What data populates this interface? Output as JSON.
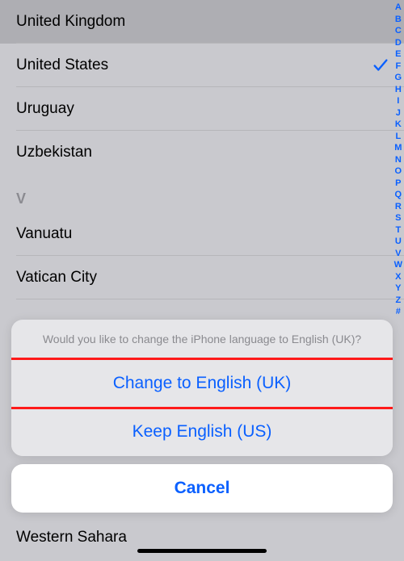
{
  "list": {
    "items": [
      {
        "label": "United Kingdom",
        "selected": false,
        "highlighted": true
      },
      {
        "label": "United States",
        "selected": true,
        "highlighted": false
      },
      {
        "label": "Uruguay",
        "selected": false,
        "highlighted": false
      },
      {
        "label": "Uzbekistan",
        "selected": false,
        "highlighted": false
      }
    ],
    "section": "V",
    "v_items": [
      {
        "label": "Vanuatu"
      },
      {
        "label": "Vatican City"
      }
    ],
    "bottom_item": "Western Sahara"
  },
  "index": [
    "A",
    "B",
    "C",
    "D",
    "E",
    "F",
    "G",
    "H",
    "I",
    "J",
    "K",
    "L",
    "M",
    "N",
    "O",
    "P",
    "Q",
    "R",
    "S",
    "T",
    "U",
    "V",
    "W",
    "X",
    "Y",
    "Z",
    "#"
  ],
  "sheet": {
    "title": "Would you like to change the iPhone language to English (UK)?",
    "change": "Change to English (UK)",
    "keep": "Keep English (US)",
    "cancel": "Cancel"
  }
}
